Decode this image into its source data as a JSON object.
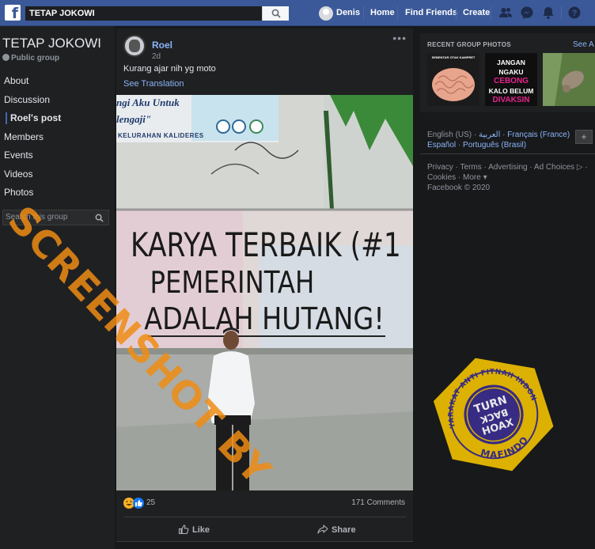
{
  "topbar": {
    "search_value": "TETAP   JOKOWI",
    "user_name": "Denis",
    "nav_home": "Home",
    "nav_find_friends": "Find Friends",
    "nav_create": "Create",
    "icons": [
      "friend-requests-icon",
      "messenger-icon",
      "notifications-icon",
      "help-icon"
    ]
  },
  "group": {
    "name": "TETAP JOKOWI",
    "type": "Public group",
    "menu": [
      "About",
      "Discussion",
      "Roel's post",
      "Members",
      "Events",
      "Videos",
      "Photos"
    ],
    "search_placeholder": "Search this group"
  },
  "post": {
    "author": "Roel",
    "time": "2d",
    "text": "Kurang ajar nih yg moto",
    "see_translation": "See Translation",
    "photo_banner_line1": "ngi Aku Untuk",
    "photo_banner_line2": "lengaji\"",
    "photo_banner_line3": "KELURAHAN KALIDERES",
    "graffiti_line1": "KARYA TERBAIK (#1",
    "graffiti_line2": "PEMERINTAH",
    "graffiti_line3": "ADALAH HUTANG!",
    "reactions_count": "25",
    "comments_count": "171 Comments",
    "like_label": "Like",
    "share_label": "Share"
  },
  "right": {
    "recent_photos_title": "RECENT GROUP PHOTOS",
    "see_all": "See A",
    "thumb2_lines": [
      "JANGAN NGAKU",
      "CEBONG",
      "KALO BELUM",
      "DIVAKSIN"
    ],
    "thumb2_footer": "...",
    "thumb1_caption": "SEBENTAR OTAK KAMPRET",
    "languages": {
      "current": "English (US)",
      "others": [
        "العربية",
        "Français (France)",
        "Español",
        "Português (Brasil)"
      ]
    },
    "footer_links": [
      "Privacy",
      "Terms",
      "Advertising",
      "Ad Choices",
      "Cookies",
      "More"
    ],
    "copyright": "Facebook © 2020"
  },
  "watermark": {
    "text": "SCREENSHOT BY",
    "stamp_ring_top": "MASYARAKAT ANTI FITNAH INDONESIA",
    "stamp_ring_bottom": "MAFINDO",
    "stamp_center": [
      "TURN",
      "BACK",
      "HOAX"
    ]
  },
  "colors": {
    "topbar": "#3b5998",
    "background": "#18191a",
    "card": "#1f2022",
    "link": "#8ab4f8",
    "watermark_orange": "#ee8c14",
    "stamp_yellow": "#f2c200",
    "stamp_purple": "#3b2d8f"
  }
}
